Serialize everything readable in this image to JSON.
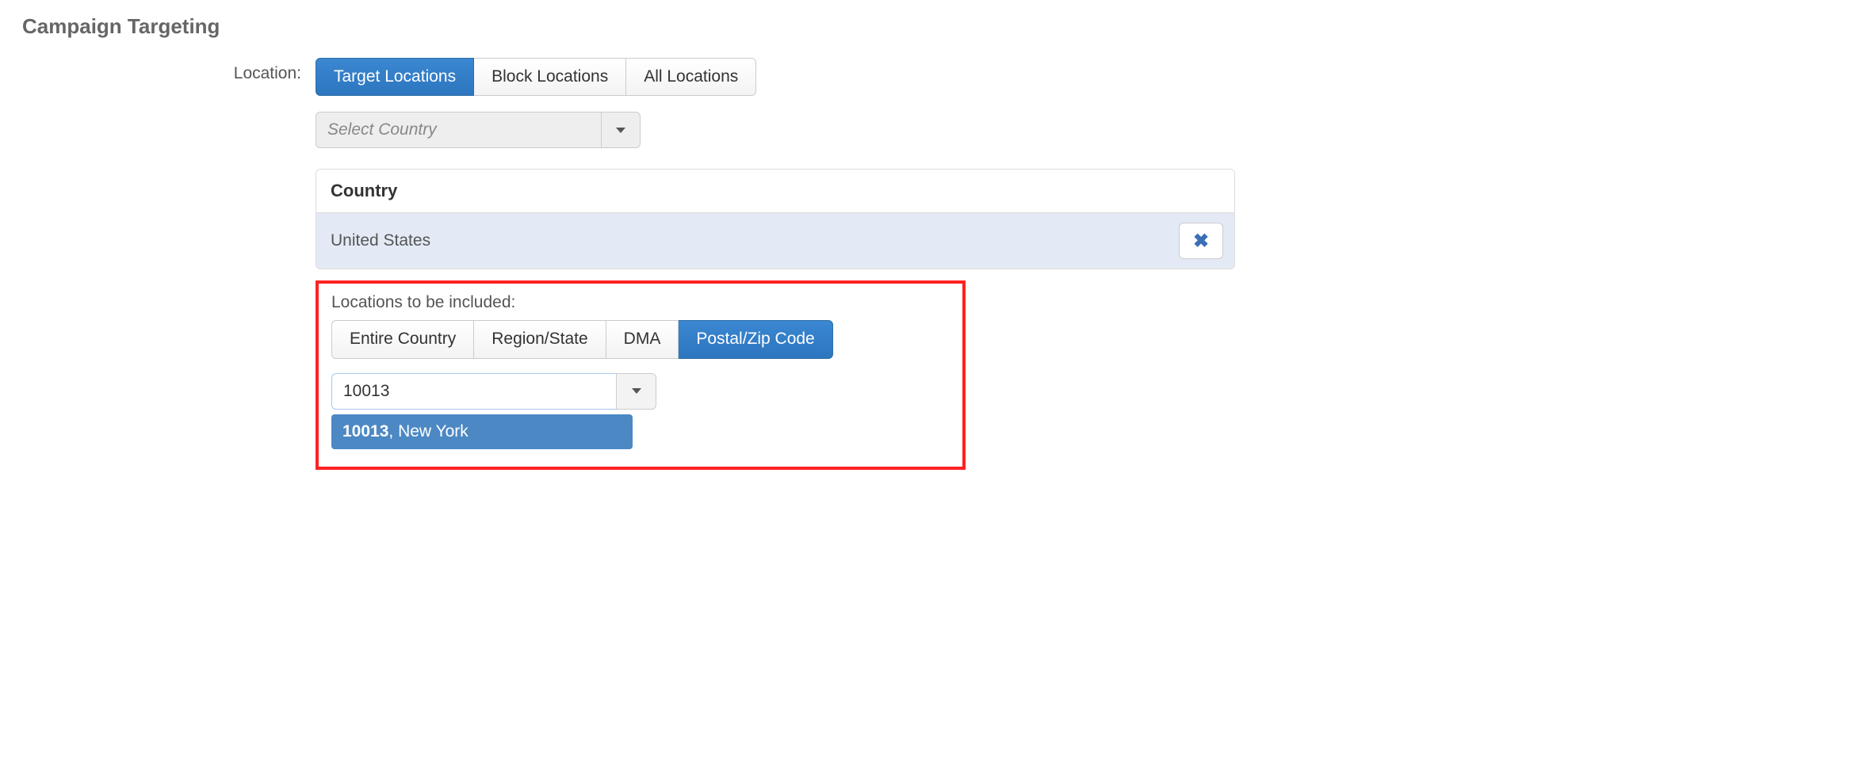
{
  "section_title": "Campaign Targeting",
  "location": {
    "label": "Location:",
    "tabs": {
      "target": "Target Locations",
      "block": "Block Locations",
      "all": "All Locations",
      "active": "target"
    },
    "country_select": {
      "placeholder": "Select Country"
    },
    "country_panel": {
      "header": "Country",
      "rows": [
        {
          "name": "United States"
        }
      ]
    },
    "include": {
      "label": "Locations to be included:",
      "tabs": {
        "entire": "Entire Country",
        "region": "Region/State",
        "dma": "DMA",
        "postal": "Postal/Zip Code",
        "active": "postal"
      },
      "zip_input": {
        "value": "10013"
      },
      "suggestion": {
        "match": "10013",
        "rest": ", New York"
      }
    }
  }
}
